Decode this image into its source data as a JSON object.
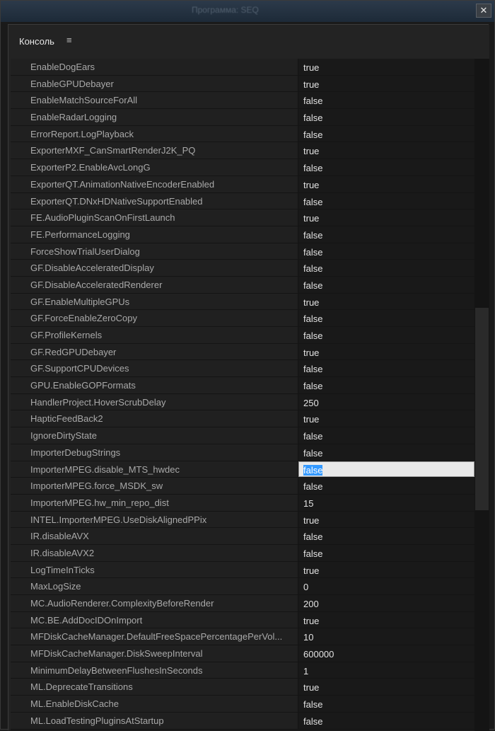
{
  "window": {
    "title": "Программа: SEQ",
    "close_label": "✕"
  },
  "panel": {
    "title": "Консоль",
    "menu_icon": "≡"
  },
  "editing_index": 24,
  "rows": [
    {
      "key": "EnableDogEars",
      "value": "true"
    },
    {
      "key": "EnableGPUDebayer",
      "value": "true"
    },
    {
      "key": "EnableMatchSourceForAll",
      "value": "false"
    },
    {
      "key": "EnableRadarLogging",
      "value": "false"
    },
    {
      "key": "ErrorReport.LogPlayback",
      "value": "false"
    },
    {
      "key": "ExporterMXF_CanSmartRenderJ2K_PQ",
      "value": "true"
    },
    {
      "key": "ExporterP2.EnableAvcLongG",
      "value": "false"
    },
    {
      "key": "ExporterQT.AnimationNativeEncoderEnabled",
      "value": "true"
    },
    {
      "key": "ExporterQT.DNxHDNativeSupportEnabled",
      "value": "false"
    },
    {
      "key": "FE.AudioPluginScanOnFirstLaunch",
      "value": "true"
    },
    {
      "key": "FE.PerformanceLogging",
      "value": "false"
    },
    {
      "key": "ForceShowTrialUserDialog",
      "value": "false"
    },
    {
      "key": "GF.DisableAcceleratedDisplay",
      "value": "false"
    },
    {
      "key": "GF.DisableAcceleratedRenderer",
      "value": "false"
    },
    {
      "key": "GF.EnableMultipleGPUs",
      "value": "true"
    },
    {
      "key": "GF.ForceEnableZeroCopy",
      "value": "false"
    },
    {
      "key": "GF.ProfileKernels",
      "value": "false"
    },
    {
      "key": "GF.RedGPUDebayer",
      "value": "true"
    },
    {
      "key": "GF.SupportCPUDevices",
      "value": "false"
    },
    {
      "key": "GPU.EnableGOPFormats",
      "value": "false"
    },
    {
      "key": "HandlerProject.HoverScrubDelay",
      "value": "250"
    },
    {
      "key": "HapticFeedBack2",
      "value": "true"
    },
    {
      "key": "IgnoreDirtyState",
      "value": "false"
    },
    {
      "key": "ImporterDebugStrings",
      "value": "false"
    },
    {
      "key": "ImporterMPEG.disable_MTS_hwdec",
      "value": "false"
    },
    {
      "key": "ImporterMPEG.force_MSDK_sw",
      "value": "false"
    },
    {
      "key": "ImporterMPEG.hw_min_repo_dist",
      "value": "15"
    },
    {
      "key": "INTEL.ImporterMPEG.UseDiskAlignedPPix",
      "value": "true"
    },
    {
      "key": "IR.disableAVX",
      "value": "false"
    },
    {
      "key": "IR.disableAVX2",
      "value": "false"
    },
    {
      "key": "LogTimeInTicks",
      "value": "true"
    },
    {
      "key": "MaxLogSize",
      "value": "0"
    },
    {
      "key": "MC.AudioRenderer.ComplexityBeforeRender",
      "value": "200"
    },
    {
      "key": "MC.BE.AddDocIDOnImport",
      "value": "true"
    },
    {
      "key": "MFDiskCacheManager.DefaultFreeSpacePercentagePerVol...",
      "value": "10"
    },
    {
      "key": "MFDiskCacheManager.DiskSweepInterval",
      "value": "600000"
    },
    {
      "key": "MinimumDelayBetweenFlushesInSeconds",
      "value": "1"
    },
    {
      "key": "ML.DeprecateTransitions",
      "value": "true"
    },
    {
      "key": "ML.EnableDiskCache",
      "value": "false"
    },
    {
      "key": "ML.LoadTestingPluginsAtStartup",
      "value": "false"
    }
  ]
}
